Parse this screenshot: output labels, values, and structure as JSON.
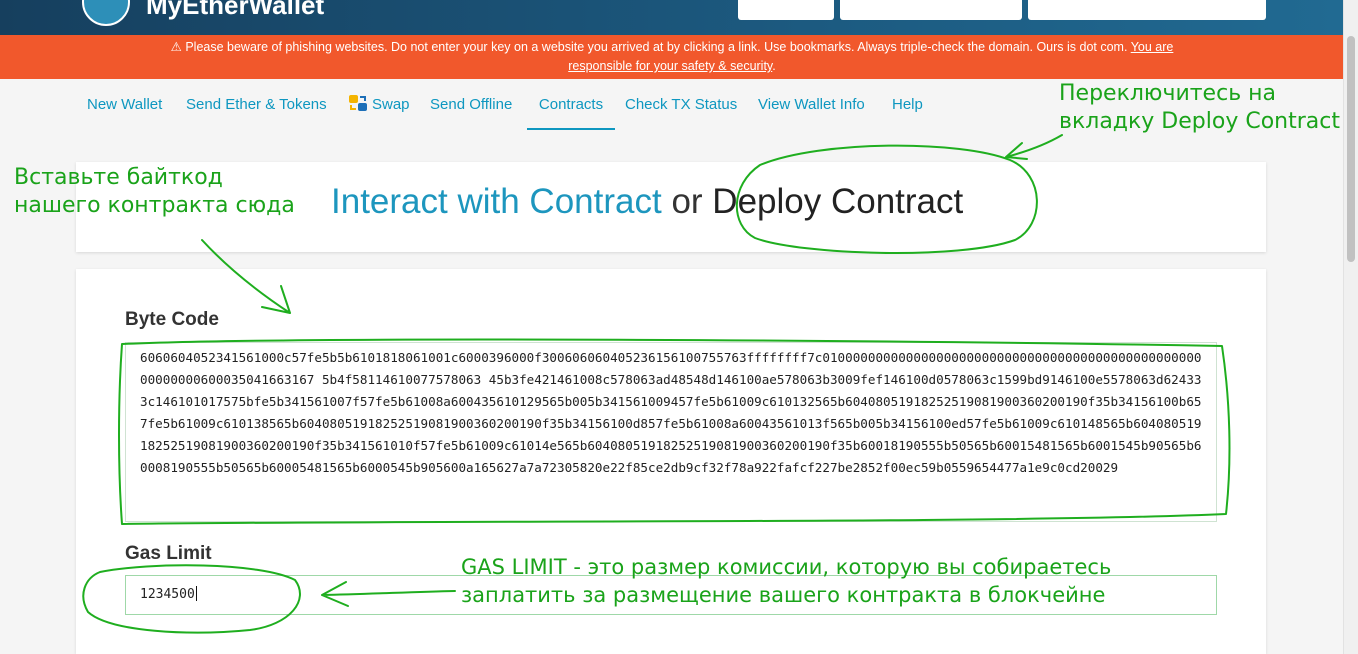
{
  "header": {
    "app_name": "MyEtherWallet"
  },
  "warning": {
    "text": "⚠ Please beware of phishing websites. Do not enter your key on a website you arrived at by clicking a link. Use bookmarks. Always triple-check the domain. Ours is dot com.",
    "link_line1": "You are",
    "link_line2": "responsible for your safety & security",
    "suffix": "."
  },
  "nav": {
    "items": [
      {
        "label": "New Wallet"
      },
      {
        "label": "Send Ether & Tokens"
      },
      {
        "label": "Swap"
      },
      {
        "label": "Send Offline"
      },
      {
        "label": "Contracts"
      },
      {
        "label": "Check TX Status"
      },
      {
        "label": "View Wallet Info"
      },
      {
        "label": "Help"
      }
    ],
    "active": "Contracts"
  },
  "title": {
    "interact": "Interact with Contract",
    "or": "or",
    "deploy": "Deploy Contract"
  },
  "form": {
    "bytecode_label": "Byte Code",
    "bytecode_value": "6060604052341561000c57fe5b5b6101818061001c6000396000f300606060405236156100755763ffffffff7c0100000000000000000000000000000000000000000000000000000000600035041663167 5b4f58114610077578063 45b3fe421461008c578063ad48548d146100ae578063b3009fef146100d0578063c1599bd9146100e5578063d624333c146101017575bfe5b341561007f57fe5b61008a600435610129565b005b341561009457fe5b61009c610132565b60408051918252519081900360200190f35b34156100b657fe5b61009c610138565b60408051918252519081900360200190f35b34156100d857fe5b61008a60043561013f565b005b34156100ed57fe5b61009c610148565b60408051918252519081900360200190f35b341561010f57fe5b61009c61014e565b60408051918252519081900360200190f35b60018190555b50565b60015481565b6001545b90565b60008190555b50565b60005481565b6000545b905600a165627a7a72305820e22f85ce2db9cf32f78a922fafcf227be2852f00ec59b0559654477a1e9c0cd20029",
    "gas_label": "Gas Limit",
    "gas_value": "1234500"
  },
  "annotations": {
    "switch_tab": [
      "Переключитесь на",
      "вкладку Deploy Contract"
    ],
    "paste_bytecode": [
      "Вставьте байткод",
      "нашего контракта сюда"
    ],
    "gas_note": [
      "GAS LIMIT - это размер комиссии, которую вы собираетесь",
      "заплатить за размещение вашего контракта в блокчейне"
    ]
  },
  "colors": {
    "warning_bg": "#f1582c",
    "accent": "#0e97c0",
    "annotation": "#1aa31a"
  }
}
